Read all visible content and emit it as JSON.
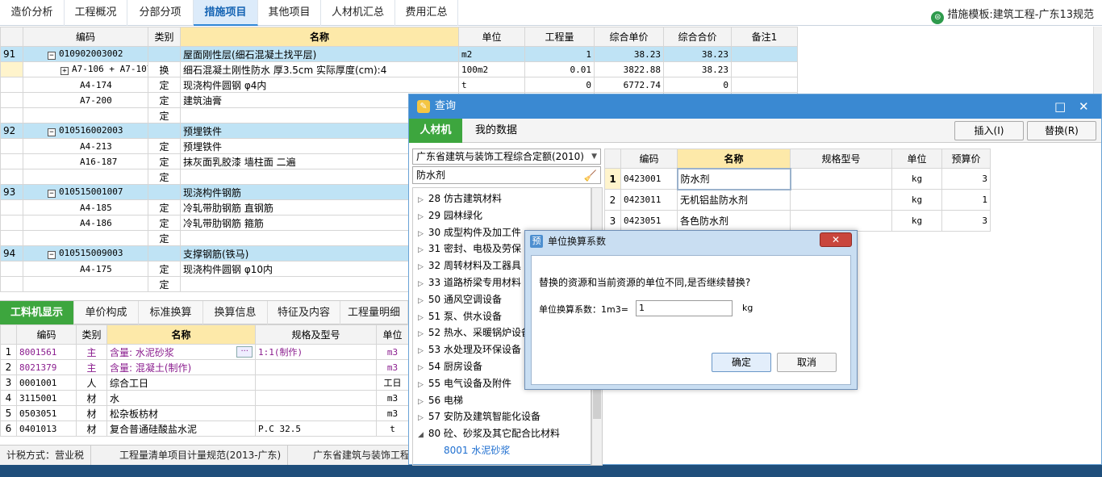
{
  "nav": {
    "tabs": [
      "造价分析",
      "工程概况",
      "分部分项",
      "措施项目",
      "其他项目",
      "人材机汇总",
      "费用汇总"
    ],
    "active": "措施项目",
    "template": "措施模板:建筑工程-广东13规范"
  },
  "main_table": {
    "headers": [
      "编码",
      "类别",
      "名称",
      "单位",
      "工程量",
      "综合单价",
      "综合合价",
      "备注1"
    ],
    "rows": [
      {
        "idx": "91",
        "tog": "−",
        "code": "010902003002",
        "type": "",
        "name": "屋面刚性层(细石混凝土找平层)",
        "unit": "m2",
        "qty": "1",
        "price": "38.23",
        "total": "38.23",
        "style": "blue"
      },
      {
        "idx": "",
        "tog": "+",
        "code": "A7-106 + A7-107",
        "type": "换",
        "name": "细石混凝土刚性防水 厚3.5cm  实际厚度(cm):4",
        "unit": "100m2",
        "qty": "0.01",
        "price": "3822.88",
        "total": "38.23",
        "style": "yel"
      },
      {
        "idx": "",
        "tog": "",
        "code": "A4-174",
        "type": "定",
        "name": "现浇构件圆钢 φ4内",
        "unit": "t",
        "qty": "0",
        "price": "6772.74",
        "total": "0",
        "style": ""
      },
      {
        "idx": "",
        "tog": "",
        "code": "A7-200",
        "type": "定",
        "name": "建筑油膏",
        "unit": "",
        "qty": "",
        "price": "",
        "total": "",
        "style": ""
      },
      {
        "idx": "",
        "tog": "",
        "code": "",
        "type": "定",
        "name": "",
        "unit": "",
        "qty": "",
        "price": "",
        "total": "",
        "style": ""
      },
      {
        "idx": "92",
        "tog": "−",
        "code": "010516002003",
        "type": "",
        "name": "预埋铁件",
        "unit": "",
        "qty": "",
        "price": "",
        "total": "",
        "style": "blue"
      },
      {
        "idx": "",
        "tog": "",
        "code": "A4-213",
        "type": "定",
        "name": "预埋铁件",
        "unit": "",
        "qty": "",
        "price": "",
        "total": "",
        "style": ""
      },
      {
        "idx": "",
        "tog": "",
        "code": "A16-187",
        "type": "定",
        "name": "抹灰面乳胶漆 墙柱面 二遍",
        "unit": "",
        "qty": "",
        "price": "",
        "total": "",
        "style": ""
      },
      {
        "idx": "",
        "tog": "",
        "code": "",
        "type": "定",
        "name": "",
        "unit": "",
        "qty": "",
        "price": "",
        "total": "",
        "style": ""
      },
      {
        "idx": "93",
        "tog": "−",
        "code": "010515001007",
        "type": "",
        "name": "现浇构件钢筋",
        "unit": "",
        "qty": "",
        "price": "",
        "total": "",
        "style": "blue"
      },
      {
        "idx": "",
        "tog": "",
        "code": "A4-185",
        "type": "定",
        "name": "冷轧带肋钢筋 直钢筋",
        "unit": "",
        "qty": "",
        "price": "",
        "total": "",
        "style": ""
      },
      {
        "idx": "",
        "tog": "",
        "code": "A4-186",
        "type": "定",
        "name": "冷轧带肋钢筋 箍筋",
        "unit": "",
        "qty": "",
        "price": "",
        "total": "",
        "style": ""
      },
      {
        "idx": "",
        "tog": "",
        "code": "",
        "type": "定",
        "name": "",
        "unit": "",
        "qty": "",
        "price": "",
        "total": "",
        "style": ""
      },
      {
        "idx": "94",
        "tog": "−",
        "code": "010515009003",
        "type": "",
        "name": "支撑钢筋(铁马)",
        "unit": "",
        "qty": "",
        "price": "",
        "total": "",
        "style": "blue"
      },
      {
        "idx": "",
        "tog": "",
        "code": "A4-175",
        "type": "定",
        "name": "现浇构件圆钢 φ10内",
        "unit": "",
        "qty": "",
        "price": "",
        "total": "",
        "style": ""
      },
      {
        "idx": "",
        "tog": "",
        "code": "",
        "type": "定",
        "name": "",
        "unit": "",
        "qty": "",
        "price": "",
        "total": "",
        "style": ""
      }
    ]
  },
  "bottom_tabs": [
    "工料机显示",
    "单价构成",
    "标准换算",
    "换算信息",
    "特征及内容",
    "工程量明细"
  ],
  "lower_table": {
    "headers": [
      "编码",
      "类别",
      "名称",
      "规格及型号",
      "单位"
    ],
    "rows": [
      {
        "n": "1",
        "code": "8001561",
        "type": "主",
        "name": "含量: 水泥砂浆",
        "spec": "1:1(制作)",
        "unit": "m3",
        "purple": true
      },
      {
        "n": "2",
        "code": "8021379",
        "type": "主",
        "name": "含量: 混凝土(制作)",
        "spec": "",
        "unit": "m3",
        "purple": true
      },
      {
        "n": "3",
        "code": "0001001",
        "type": "人",
        "name": "综合工日",
        "spec": "",
        "unit": "工日",
        "purple": false
      },
      {
        "n": "4",
        "code": "3115001",
        "type": "材",
        "name": "水",
        "spec": "",
        "unit": "m3",
        "purple": false
      },
      {
        "n": "5",
        "code": "0503051",
        "type": "材",
        "name": "松杂板枋材",
        "spec": "",
        "unit": "m3",
        "purple": false
      },
      {
        "n": "6",
        "code": "0401013",
        "type": "材",
        "name": "复合普通硅酸盐水泥",
        "spec": "P.C 32.5",
        "unit": "t",
        "purple": false
      }
    ],
    "ellipsis": "···"
  },
  "status": {
    "tax": "计税方式：营业税",
    "spec": "工程量清单项目计量规范(2013-广东)",
    "quota": "广东省建筑与装饰工程"
  },
  "query": {
    "title": "查询",
    "maximize": "□",
    "close": "✕",
    "tabs": [
      "人材机",
      "我的数据"
    ],
    "insert_btn": "插入(I)",
    "replace_btn": "替换(R)",
    "quota_select": "广东省建筑与装饰工程综合定额(2010)",
    "dd": "▼",
    "search_value": "防水剂",
    "broom": "🧹",
    "tree": [
      {
        "ar": "▷",
        "label": "28 仿古建筑材料"
      },
      {
        "ar": "▷",
        "label": "29 园林绿化"
      },
      {
        "ar": "▷",
        "label": "30 成型构件及加工件"
      },
      {
        "ar": "▷",
        "label": "31 密封、电极及劳保"
      },
      {
        "ar": "▷",
        "label": "32 周转材料及工器具"
      },
      {
        "ar": "▷",
        "label": "33 道路桥梁专用材料"
      },
      {
        "ar": "▷",
        "label": "50 通风空调设备"
      },
      {
        "ar": "▷",
        "label": "51 泵、供水设备"
      },
      {
        "ar": "▷",
        "label": "52 热水、采暖锅炉设备"
      },
      {
        "ar": "▷",
        "label": "53 水处理及环保设备"
      },
      {
        "ar": "▷",
        "label": "54 厨房设备"
      },
      {
        "ar": "▷",
        "label": "55 电气设备及附件"
      },
      {
        "ar": "▷",
        "label": "56 电梯"
      },
      {
        "ar": "▷",
        "label": "57 安防及建筑智能化设备"
      },
      {
        "ar": "◢",
        "label": "80 砼、砂浆及其它配合比材料"
      }
    ],
    "tree_sub": "8001 水泥砂浆",
    "headers": [
      "编码",
      "名称",
      "规格型号",
      "单位",
      "预算价"
    ],
    "rows": [
      {
        "n": "1",
        "code": "0423001",
        "name": "防水剂",
        "spec": "",
        "unit": "kg",
        "price": "3"
      },
      {
        "n": "2",
        "code": "0423011",
        "name": "无机铝盐防水剂",
        "spec": "",
        "unit": "kg",
        "price": "1"
      },
      {
        "n": "3",
        "code": "0423051",
        "name": "各色防水剂",
        "spec": "",
        "unit": "kg",
        "price": "3"
      }
    ]
  },
  "dialog": {
    "icon": "预",
    "title": "单位换算系数",
    "close": "✕",
    "message": "替换的资源和当前资源的单位不同,是否继续替换?",
    "factor_label": "单位换算系数：1m3=",
    "factor_value": "1",
    "factor_unit": "kg",
    "ok": "确定",
    "cancel": "取消"
  }
}
